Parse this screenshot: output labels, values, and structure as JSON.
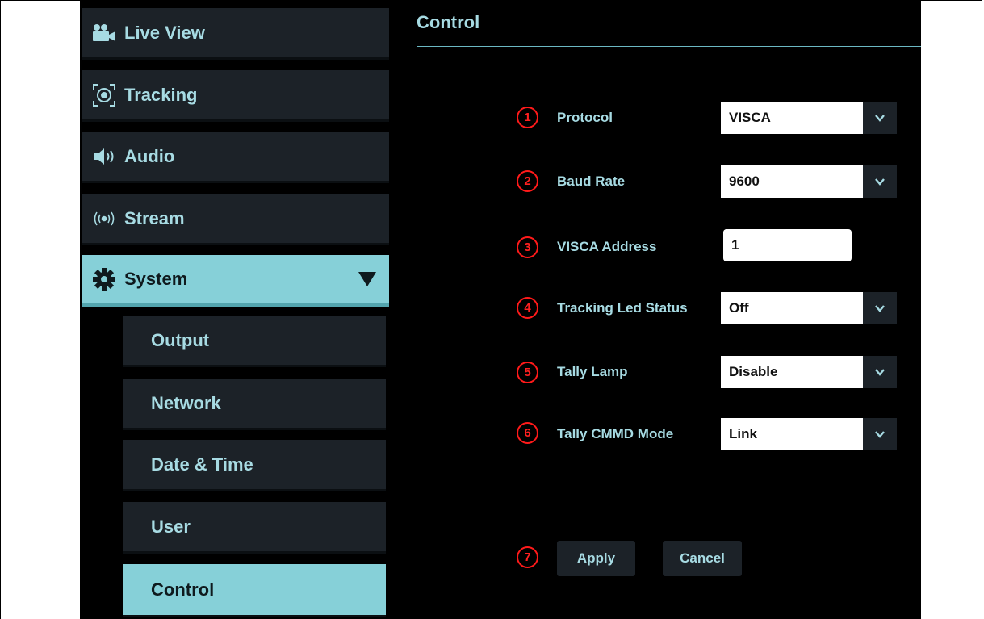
{
  "sidebar": {
    "items": [
      {
        "label": "Live View",
        "icon": "video-camera-icon"
      },
      {
        "label": "Tracking",
        "icon": "target-icon"
      },
      {
        "label": "Audio",
        "icon": "speaker-icon"
      },
      {
        "label": "Stream",
        "icon": "broadcast-icon"
      },
      {
        "label": "System",
        "icon": "gear-icon",
        "expanded": true
      }
    ],
    "subitems": [
      {
        "label": "Output"
      },
      {
        "label": "Network"
      },
      {
        "label": "Date & Time"
      },
      {
        "label": "User"
      },
      {
        "label": "Control",
        "active": true
      }
    ]
  },
  "content": {
    "title": "Control",
    "fields": [
      {
        "num": "1",
        "label": "Protocol",
        "value": "VISCA",
        "type": "select"
      },
      {
        "num": "2",
        "label": "Baud Rate",
        "value": "9600",
        "type": "select"
      },
      {
        "num": "3",
        "label": "VISCA Address",
        "value": "1",
        "type": "input"
      },
      {
        "num": "4",
        "label": "Tracking Led Status",
        "value": "Off",
        "type": "select"
      },
      {
        "num": "5",
        "label": "Tally Lamp",
        "value": "Disable",
        "type": "select"
      },
      {
        "num": "6",
        "label": "Tally CMMD Mode",
        "value": "Link",
        "type": "select"
      }
    ],
    "actions": {
      "num": "7",
      "apply": "Apply",
      "cancel": "Cancel"
    }
  },
  "colors": {
    "accent": "#86d0d8",
    "text": "#a7dbe3",
    "panel": "#1c2228",
    "background": "#000000",
    "marker": "#ff1a1a"
  }
}
